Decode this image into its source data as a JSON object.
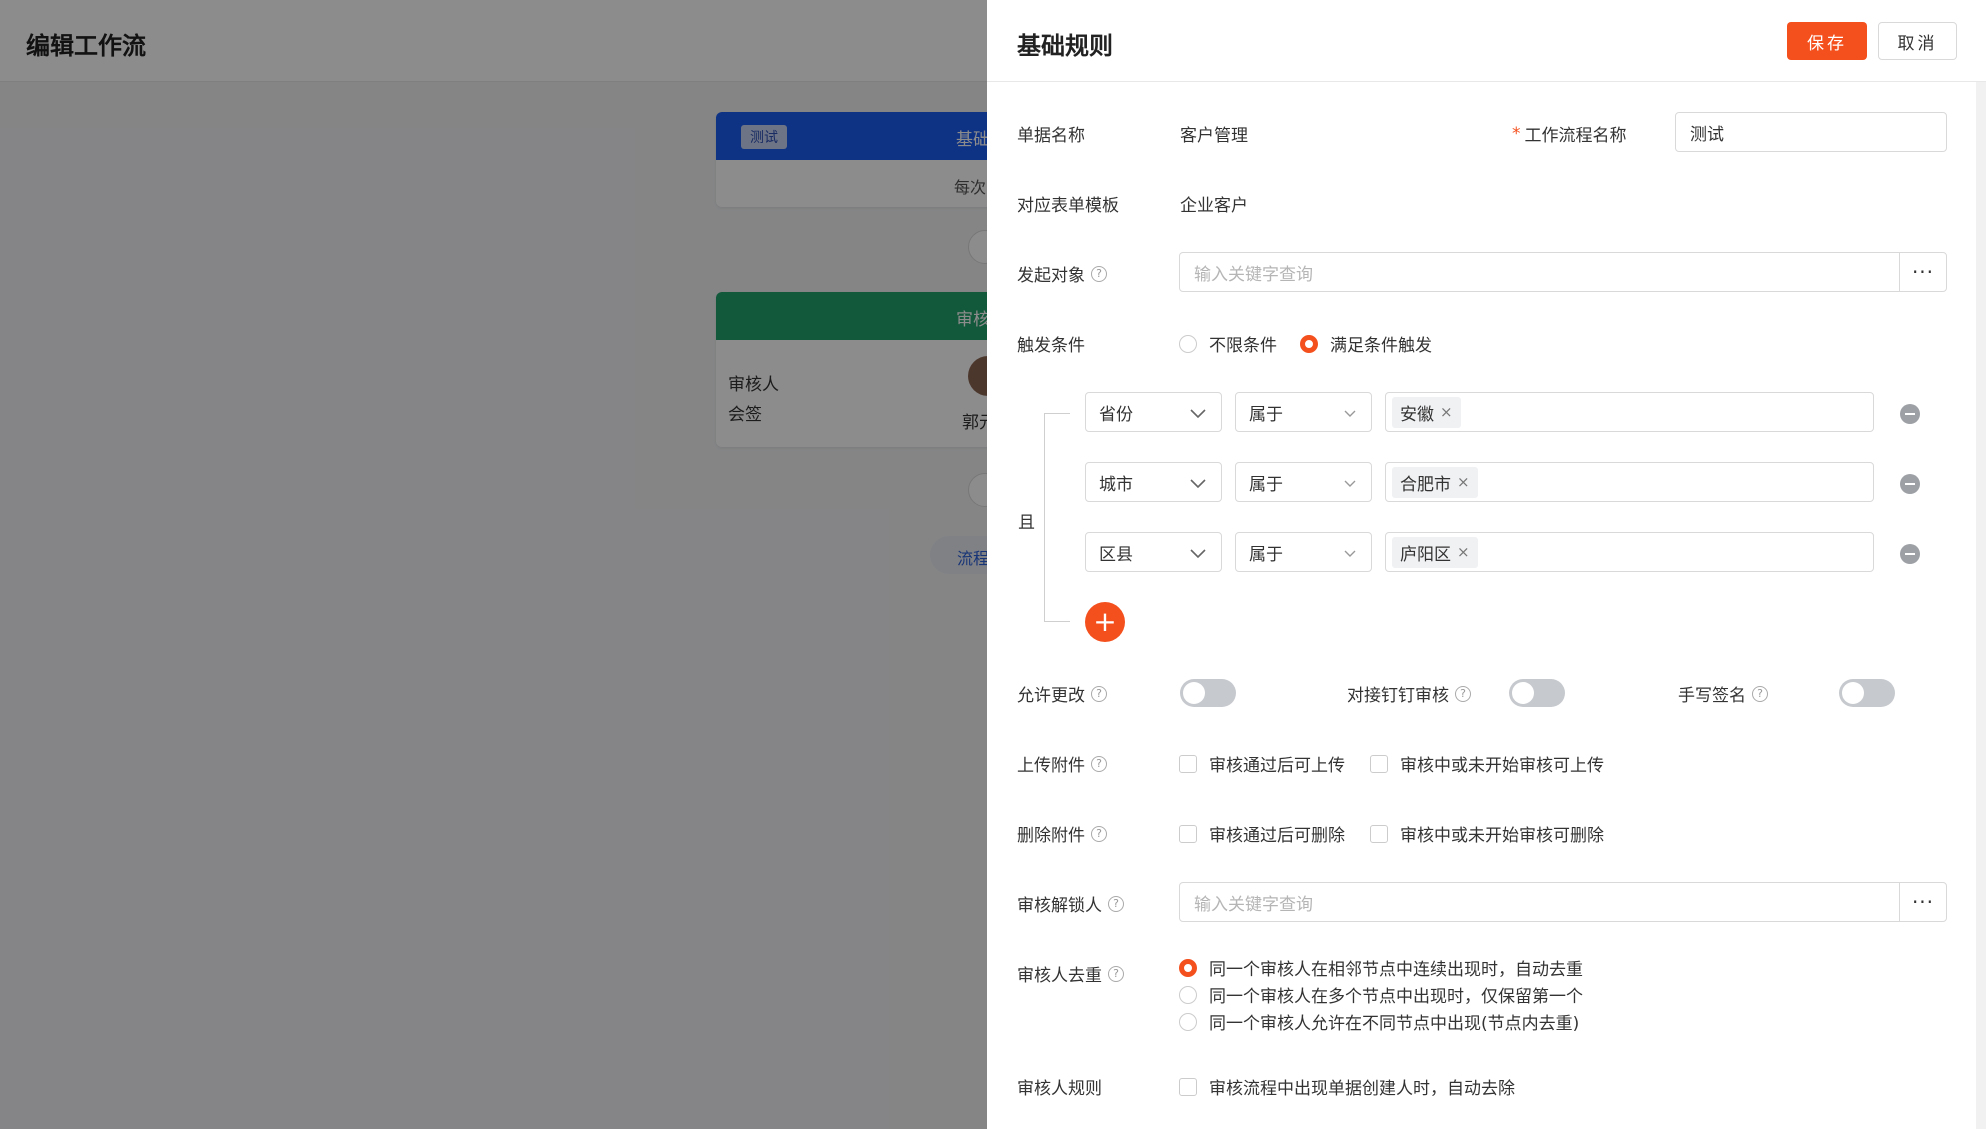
{
  "background": {
    "title": "编辑工作流",
    "node1": {
      "tag": "测试",
      "title": "基础",
      "body": "每次"
    },
    "node2": {
      "title": "审核",
      "line1": "审核人",
      "line2": "会签",
      "assignee": "郭元"
    },
    "end_label": "流程"
  },
  "drawer": {
    "title": "基础规则",
    "save_label": "保存",
    "cancel_label": "取消"
  },
  "form": {
    "doc_name": {
      "label": "单据名称",
      "value": "客户管理"
    },
    "workflow_name": {
      "label": "工作流程名称",
      "required_mark": "*",
      "value": "测试"
    },
    "template": {
      "label": "对应表单模板",
      "value": "企业客户"
    },
    "initiator": {
      "label": "发起对象",
      "placeholder": "输入关键字查询",
      "more": "···"
    },
    "trigger": {
      "label": "触发条件",
      "options": [
        "不限条件",
        "满足条件触发"
      ],
      "selected_index": 1,
      "logic_label": "且",
      "conditions": [
        {
          "field": "省份",
          "operator": "属于",
          "value": "安徽"
        },
        {
          "field": "城市",
          "operator": "属于",
          "value": "合肥市"
        },
        {
          "field": "区县",
          "operator": "属于",
          "value": "庐阳区"
        }
      ],
      "add_symbol": "+"
    },
    "allow_edit": {
      "label": "允许更改",
      "on": false
    },
    "dingtalk": {
      "label": "对接钉钉审核",
      "on": false
    },
    "signature": {
      "label": "手写签名",
      "on": false
    },
    "upload": {
      "label": "上传附件",
      "options": [
        "审核通过后可上传",
        "审核中或未开始审核可上传"
      ]
    },
    "delete": {
      "label": "删除附件",
      "options": [
        "审核通过后可删除",
        "审核中或未开始审核可删除"
      ]
    },
    "unlocker": {
      "label": "审核解锁人",
      "placeholder": "输入关键字查询",
      "more": "···"
    },
    "dedupe": {
      "label": "审核人去重",
      "options": [
        "同一个审核人在相邻节点中连续出现时，自动去重",
        "同一个审核人在多个节点中出现时，仅保留第一个",
        "同一个审核人允许在不同节点中出现(节点内去重)"
      ],
      "selected_index": 0
    },
    "rule": {
      "label": "审核人规则",
      "option": "审核流程中出现单据创建人时，自动去除"
    }
  },
  "colors": {
    "accent": "#f4501e",
    "node_blue": "#1a5bf0",
    "node_green": "#22a16b"
  },
  "icons": {
    "help": "question-circle-icon",
    "more": "ellipsis-icon",
    "remove": "minus-circle-icon",
    "add": "plus-circle-icon",
    "chevron": "chevron-down-icon",
    "close": "close-icon"
  }
}
